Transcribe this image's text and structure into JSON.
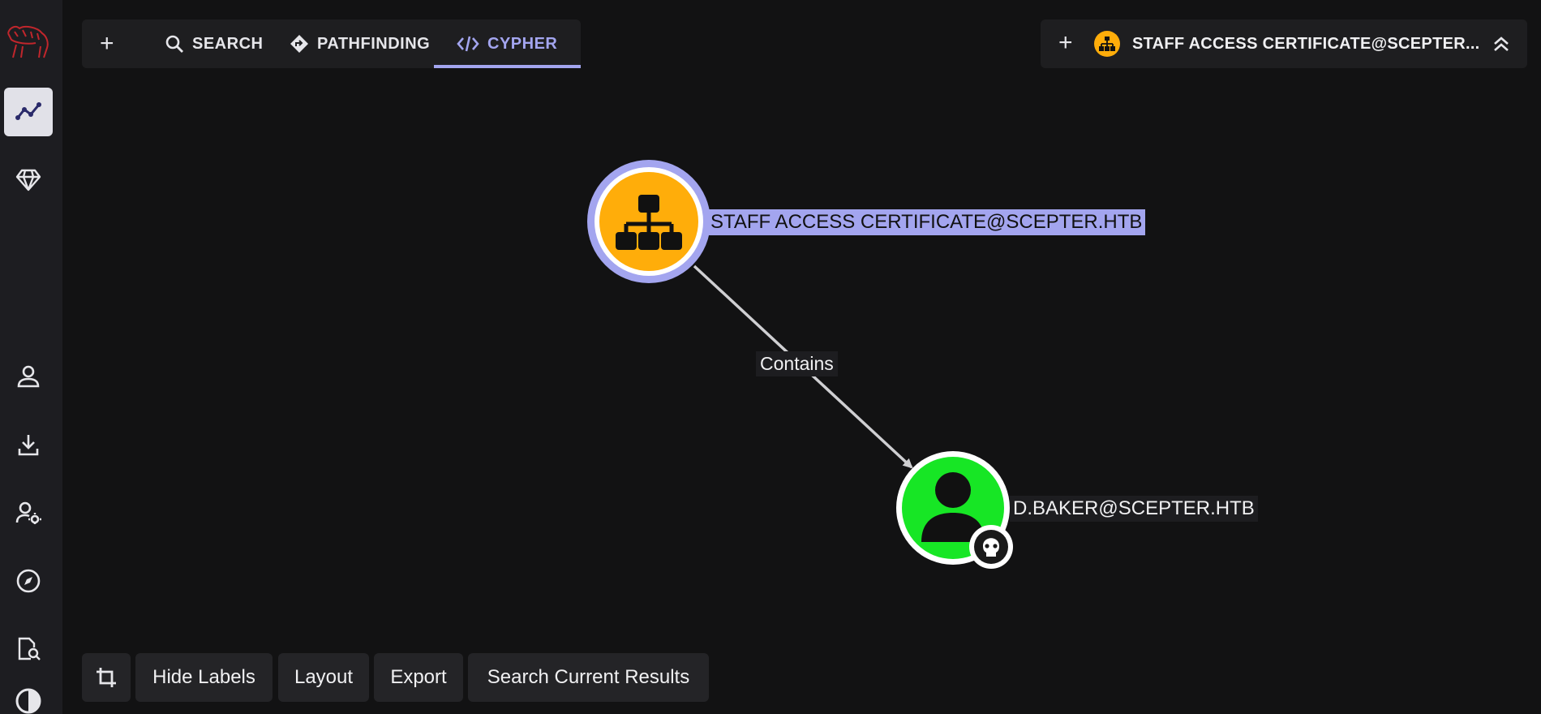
{
  "tabs": {
    "add": "+",
    "search": "SEARCH",
    "pathfinding": "PATHFINDING",
    "cypher": "CYPHER"
  },
  "selection": {
    "add": "+",
    "title": "STAFF ACCESS CERTIFICATE@SCEPTER...",
    "collapse_icon": "chevrons-up-icon"
  },
  "graph": {
    "nodes": [
      {
        "label": "STAFF ACCESS CERTIFICATE@SCEPTER.HTB",
        "kind": "OU",
        "color": "#ffad0a",
        "selected": true
      },
      {
        "label": "D.BAKER@SCEPTER.HTB",
        "kind": "User",
        "color": "#17e625",
        "owned": true
      }
    ],
    "edge": {
      "label": "Contains"
    }
  },
  "bottom_bar": {
    "hide_labels": "Hide Labels",
    "layout": "Layout",
    "export": "Export",
    "search_results": "Search Current Results"
  },
  "sidebar": {
    "items": [
      "logo",
      "explore",
      "group-management",
      "profile",
      "download-collectors",
      "administration",
      "api-explorer",
      "docs",
      "theme"
    ]
  },
  "colors": {
    "accent": "#a3a5ef",
    "ou_node": "#ffad0a",
    "user_node": "#17e625",
    "background": "#121213"
  }
}
